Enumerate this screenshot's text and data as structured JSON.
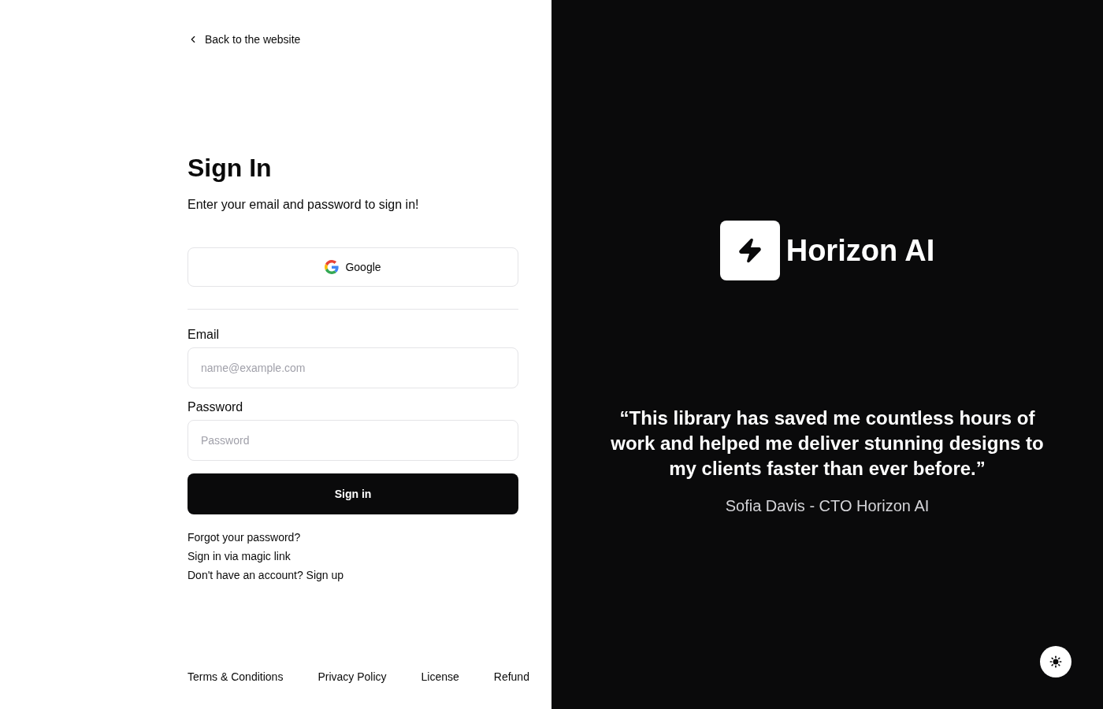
{
  "back_link": "Back to the website",
  "title": "Sign In",
  "subtitle": "Enter your email and password to sign in!",
  "oauth_button": "Google",
  "fields": [
    {
      "label": "Email",
      "placeholder": "name@example.com"
    },
    {
      "label": "Password",
      "placeholder": "Password"
    }
  ],
  "submit_button": "Sign in",
  "links": [
    "Forgot your password?",
    "Sign in via magic link",
    "Don't have an account? Sign up"
  ],
  "footer_links": [
    "Terms & Conditions",
    "Privacy Policy",
    "License",
    "Refund"
  ],
  "brand": {
    "name": "Horizon AI"
  },
  "testimonial": {
    "quote": "“This library has saved me countless hours of work and helped me deliver stunning designs to my clients faster than ever before.”",
    "author": "Sofia Davis - CTO Horizon AI"
  }
}
